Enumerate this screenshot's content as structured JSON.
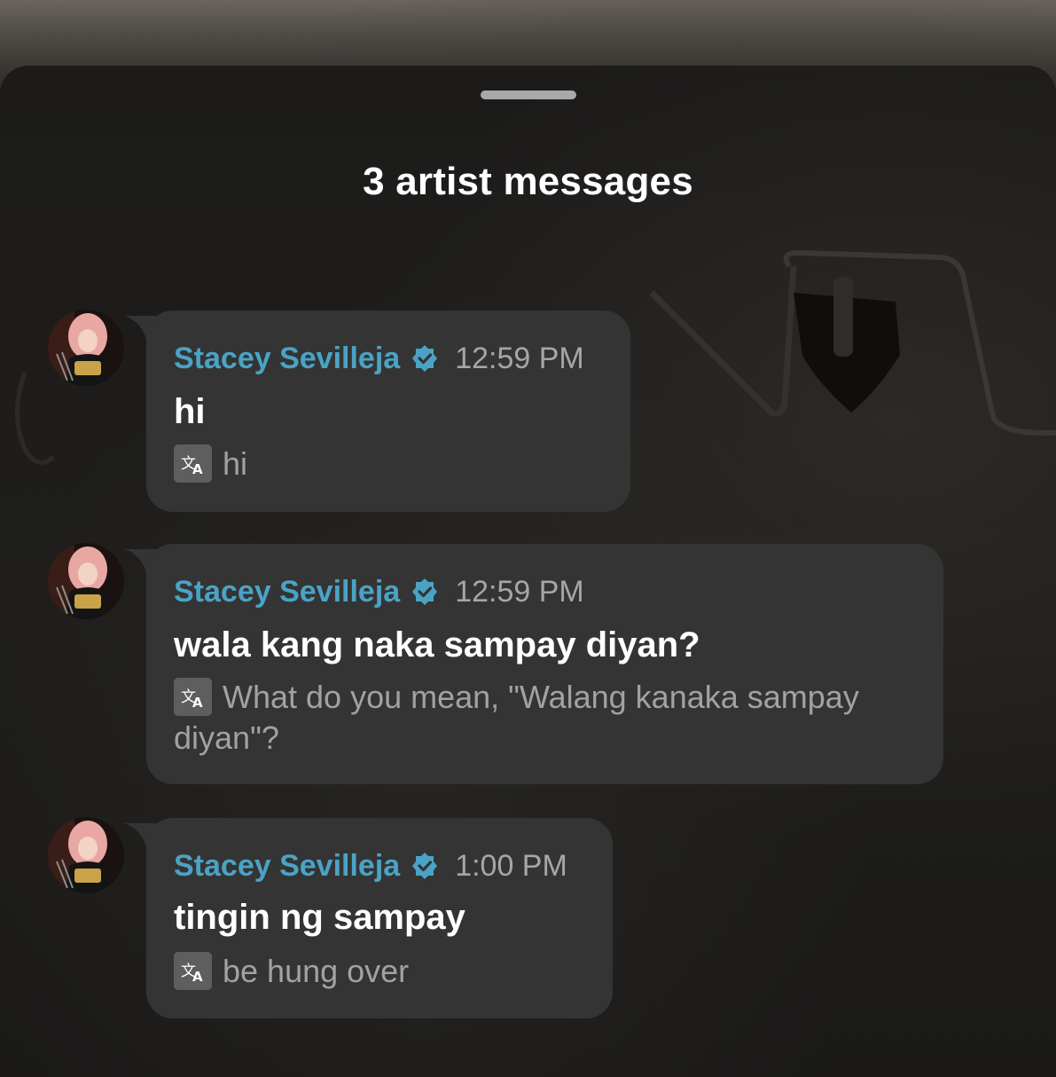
{
  "sheet": {
    "title": "3 artist messages"
  },
  "messages": [
    {
      "sender": "Stacey Sevilleja",
      "time": "12:59 PM",
      "text": "hi",
      "translation": "hi"
    },
    {
      "sender": "Stacey Sevilleja",
      "time": "12:59 PM",
      "text": "wala kang naka sampay diyan?",
      "translation": "What do you mean, \"Walang kanaka sampay diyan\"?"
    },
    {
      "sender": "Stacey Sevilleja",
      "time": "1:00 PM",
      "text": "tingin ng sampay",
      "translation": "be hung over"
    }
  ],
  "colors": {
    "sender": "#4aa3c5",
    "bubble": "#343434",
    "verified": "#4aa3c5"
  },
  "icons": {
    "verified": "verified-badge-icon",
    "translate": "translate-icon"
  }
}
